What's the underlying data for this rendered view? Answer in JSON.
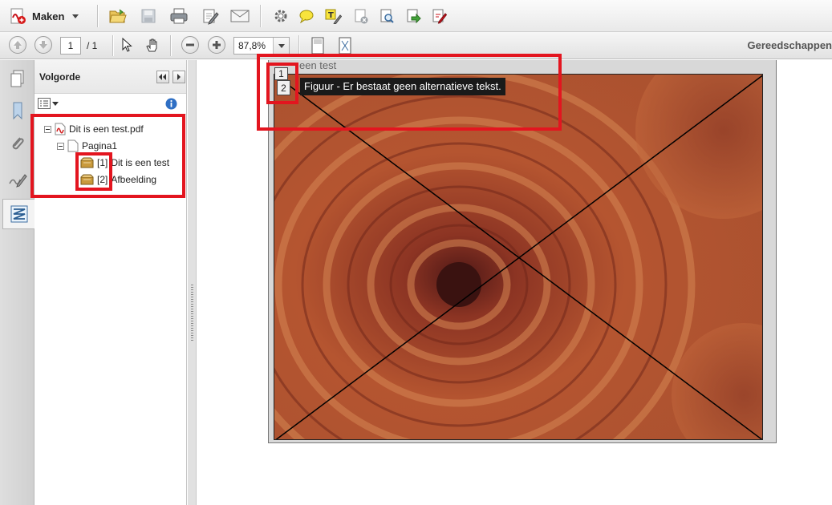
{
  "toolbar": {
    "create_label": "Maken",
    "page_current": "1",
    "page_total": "/ 1",
    "zoom": "87,8%",
    "tools_label": "Gereedschappen"
  },
  "panel": {
    "title": "Volgorde"
  },
  "tree": {
    "file": "Dit is een test.pdf",
    "page": "Pagina1",
    "items": [
      {
        "index": "[1]",
        "label": "Dit is een test"
      },
      {
        "index": "[2]",
        "label": "Afbeelding"
      }
    ]
  },
  "document": {
    "text_line": "een test",
    "tag_1": "1",
    "tag_2": "2",
    "tooltip": "Figuur - Er bestaat geen alternatieve tekst."
  },
  "colors": {
    "highlight": "#e3151f",
    "tooltip_bg": "#1a1a1a"
  }
}
